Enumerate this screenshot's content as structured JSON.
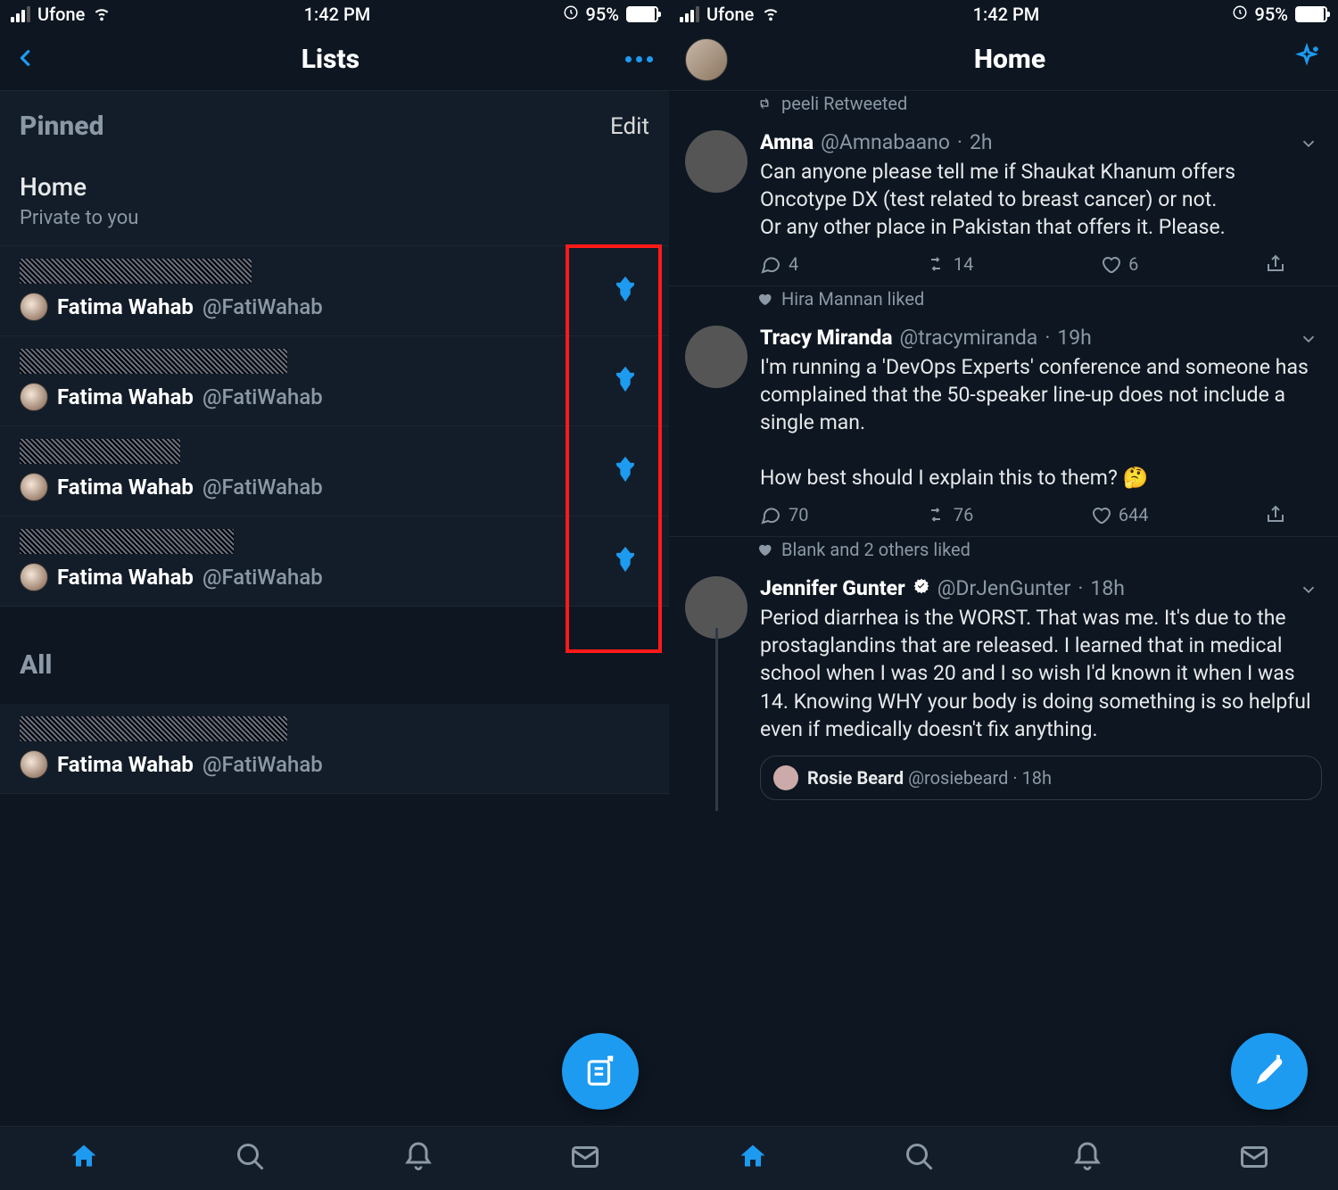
{
  "status": {
    "carrier": "Ufone",
    "time": "1:42 PM",
    "battery_pct": "95%"
  },
  "left": {
    "nav_title": "Lists",
    "pinned_label": "Pinned",
    "edit_label": "Edit",
    "home_item": {
      "name": "Home",
      "sub": "Private to you"
    },
    "list_author": {
      "name": "Fatima Wahab",
      "handle": "@FatiWahab"
    },
    "all_label": "All"
  },
  "right": {
    "nav_title": "Home",
    "tweets": [
      {
        "context_icon": "retweet",
        "context": "peeli Retweeted",
        "name": "Amna",
        "handle": "@Amnabaano",
        "time": "2h",
        "text": "Can anyone please tell me if Shaukat Khanum offers Oncotype DX (test related to breast cancer) or not.\nOr any other place in Pakistan that offers it. Please.",
        "replies": "4",
        "retweets": "14",
        "likes": "6"
      },
      {
        "context_icon": "like",
        "context": "Hira Mannan liked",
        "name": "Tracy Miranda",
        "handle": "@tracymiranda",
        "time": "19h",
        "text": "I'm running a 'DevOps Experts' conference and someone has complained that the 50-speaker line-up does not include a single man.\n\nHow best should I explain this to them? 🤔",
        "replies": "70",
        "retweets": "76",
        "likes": "644"
      },
      {
        "context_icon": "like",
        "context": "Blank and 2 others liked",
        "name": "Jennifer Gunter",
        "verified": true,
        "handle": "@DrJenGunter",
        "time": "18h",
        "text": "Period diarrhea is the WORST. That was me. It's due to the prostaglandins that are released. I learned that in medical school when I was 20 and I so wish I'd known it when I was 14. Knowing WHY your body is doing something is so helpful even if medically doesn't fix anything.",
        "replies": "",
        "retweets": "",
        "likes": "",
        "quoted": {
          "name": "Rosie Beard",
          "handle": "@rosiebeard",
          "time": "18h"
        }
      }
    ]
  }
}
